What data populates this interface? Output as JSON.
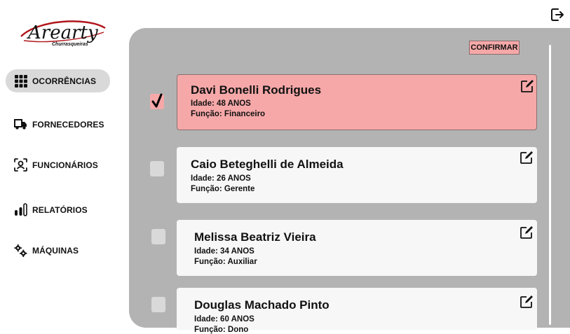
{
  "brand": {
    "logo_text": "Arearty",
    "logo_subtext": "Churrasqueiras"
  },
  "header": {
    "logout_icon": "logout-icon"
  },
  "sidebar": {
    "items": [
      {
        "label": "OCORRÊNCIAS",
        "icon": "grid-icon",
        "active": true
      },
      {
        "label": "FORNECEDORES",
        "icon": "truck-icon",
        "active": false
      },
      {
        "label": "FUNCIONÁRIOS",
        "icon": "person-scan-icon",
        "active": false
      },
      {
        "label": "RELATÓRIOS",
        "icon": "bar-chart-icon",
        "active": false
      },
      {
        "label": "MÁQUINAS",
        "icon": "gears-icon",
        "active": false
      }
    ]
  },
  "toolbar": {
    "confirm_label": "CONFIRMAR"
  },
  "employees": [
    {
      "name": "Davi Bonelli  Rodrigues",
      "age": "Idade: 48 ANOS",
      "role": "Função: Financeiro",
      "checked": true
    },
    {
      "name": "Caio Beteghelli de Almeida",
      "age": "Idade: 26 ANOS",
      "role": "Função: Gerente",
      "checked": false
    },
    {
      "name": "Melissa Beatriz Vieira",
      "age": "Idade: 34 ANOS",
      "role": "Função: Auxiliar",
      "checked": false
    },
    {
      "name": "Douglas Machado Pinto",
      "age": "Idade: 60 ANOS",
      "role": "Função: Dono",
      "checked": false
    }
  ],
  "colors": {
    "panel": "#b3b3b3",
    "selected": "#f6a8a8",
    "card": "#f7f7f7",
    "nav_active": "#d9d9d9"
  }
}
